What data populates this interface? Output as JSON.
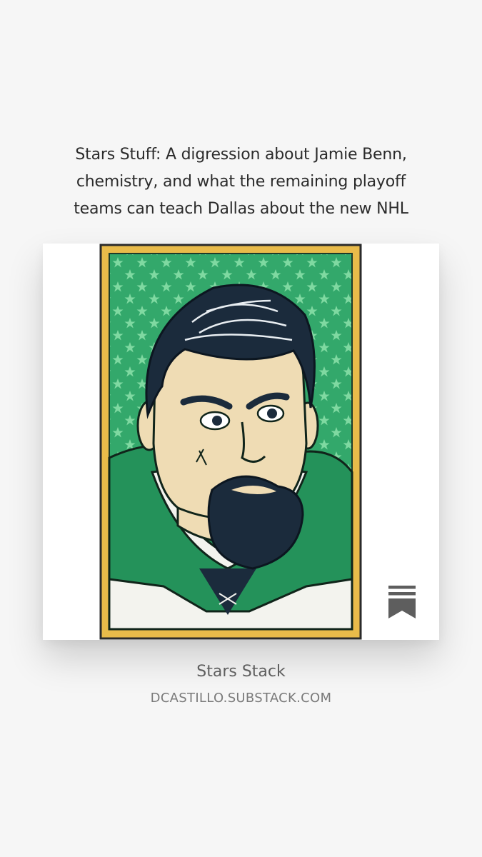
{
  "post": {
    "title_lines": [
      "Stars Stuff: A digression about Jamie Benn,",
      "chemistry, and what the remaining playoff",
      "teams can teach Dallas about the new NHL"
    ]
  },
  "card": {
    "image_icon": "portrait-illustration",
    "bookmark_icon": "substack-bookmark-icon"
  },
  "publication": {
    "name": "Stars Stack",
    "domain": "DCASTILLO.SUBSTACK.COM"
  },
  "colors": {
    "background": "#f6f6f6",
    "frame_yellow": "#e9bb4a",
    "star_green": "#33a86b",
    "jersey_green": "#24925a",
    "hair_navy": "#1b2b3c",
    "skin": "#efdcb4"
  }
}
